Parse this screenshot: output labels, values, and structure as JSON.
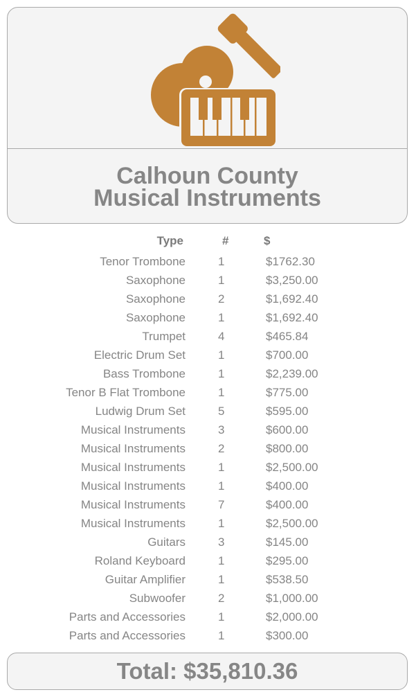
{
  "header": {
    "icon": "guitar-keyboard-icon",
    "title_line1": "Calhoun County",
    "title_line2": "Musical Instruments"
  },
  "table": {
    "columns": {
      "type": "Type",
      "qty": "#",
      "amount": "$"
    },
    "rows": [
      {
        "type": "Tenor Trombone",
        "qty": "1",
        "amount": "$1762.30"
      },
      {
        "type": "Saxophone",
        "qty": "1",
        "amount": "$3,250.00"
      },
      {
        "type": "Saxophone",
        "qty": "2",
        "amount": "$1,692.40"
      },
      {
        "type": "Saxophone",
        "qty": "1",
        "amount": "$1,692.40"
      },
      {
        "type": "Trumpet",
        "qty": "4",
        "amount": "$465.84"
      },
      {
        "type": "Electric Drum Set",
        "qty": "1",
        "amount": "$700.00"
      },
      {
        "type": "Bass Trombone",
        "qty": "1",
        "amount": "$2,239.00"
      },
      {
        "type": "Tenor B Flat Trombone",
        "qty": "1",
        "amount": "$775.00"
      },
      {
        "type": "Ludwig Drum Set",
        "qty": "5",
        "amount": "$595.00"
      },
      {
        "type": "Musical Instruments",
        "qty": "3",
        "amount": "$600.00"
      },
      {
        "type": "Musical Instruments",
        "qty": "2",
        "amount": "$800.00"
      },
      {
        "type": "Musical Instruments",
        "qty": "1",
        "amount": "$2,500.00"
      },
      {
        "type": "Musical Instruments",
        "qty": "1",
        "amount": "$400.00"
      },
      {
        "type": "Musical Instruments",
        "qty": "7",
        "amount": "$400.00"
      },
      {
        "type": "Musical Instruments",
        "qty": "1",
        "amount": "$2,500.00"
      },
      {
        "type": "Guitars",
        "qty": "3",
        "amount": "$145.00"
      },
      {
        "type": "Roland Keyboard",
        "qty": "1",
        "amount": "$295.00"
      },
      {
        "type": "Guitar Amplifier",
        "qty": "1",
        "amount": "$538.50"
      },
      {
        "type": "Subwoofer",
        "qty": "2",
        "amount": "$1,000.00"
      },
      {
        "type": "Parts and Accessories",
        "qty": "1",
        "amount": "$2,000.00"
      },
      {
        "type": "Parts and Accessories",
        "qty": "1",
        "amount": "$300.00"
      }
    ]
  },
  "total": {
    "label": "Total: $35,810.36"
  },
  "colors": {
    "accent": "#c28236",
    "text": "#858585",
    "border": "#a9a9a9",
    "card_background": "#f4f4f4"
  }
}
